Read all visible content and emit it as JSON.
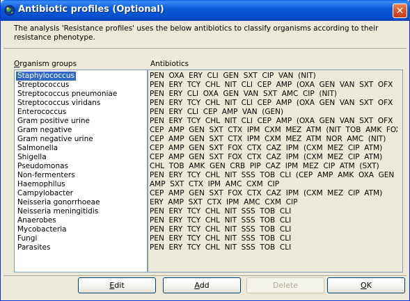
{
  "window": {
    "title": "Antibiotic profiles (Optional)",
    "close_label": "✕"
  },
  "description": "The analysis 'Resistance profiles' uses the below antibiotics to classify organisms according to their resistance phenotype.",
  "organism_groups_label": "Organism groups",
  "antibiotics_label": "Antibiotics",
  "organism_groups": [
    "Staphylococcus",
    "Streptococcus",
    "Streptococcus pneumoniae",
    "Streptococcus viridans",
    "Enterococcus",
    "Gram positive urine",
    "Gram negative",
    "Gram negative urine",
    "Salmonella",
    "Shigella",
    "Pseudomonas",
    "Non-fermenters",
    "Haemophilus",
    "Campylobacter",
    "Neisseria gonorrhoeae",
    "Neisseria meningitidis",
    "Anaerobes",
    "Mycobacteria",
    "Fungi",
    "Parasites"
  ],
  "selected_index": 0,
  "antibiotics": [
    "PEN  OXA  ERY  CLI  GEN  SXT  CIP  VAN  (NIT)",
    "PEN  ERY  TCY  CHL  NIT  CLI  CEP  AMP  (OXA  GEN  VAN  SXT  OFX  C",
    "PEN  ERY  CLI  OXA  GEN  VAN  SXT  AMC  CIP  (NIT)",
    "PEN  ERY  TCY  CHL  NIT  CLI  CEP  AMP  (OXA  GEN  VAN  SXT  OFX  C",
    "PEN  ERY  CLI  CEP  AMP  VAN  (GEN)",
    "PEN  ERY  TCY  CHL  NIT  CLI  CEP  AMP  (OXA  GEN  VAN  SXT  OFX  C",
    "CEP  AMP  GEN  SXT  CTX  IPM  CXM  MEZ  ATM  (NIT  TOB  AMK  FOX",
    "CEP  AMP  GEN  SXT  CTX  IPM  CXM  MEZ  ATM  NOR  AMC  (NIT)",
    "CEP  AMP  GEN  SXT  FOX  CTX  CAZ  IPM  (CXM  MEZ  CIP  ATM)",
    "CEP  AMP  GEN  SXT  FOX  CTX  CAZ  IPM  (CXM  MEZ  CIP  ATM)",
    "CHL  TOB  AMK  GEN  CRB  PIP  CAZ  IPM  MEZ  CIP  ATM  (SXT)",
    "PEN  ERY  TCY  CHL  NIT  SSS  TOB  CLI  (CEP  AMP  AMK  OXA  GEN",
    "AMP  SXT  CTX  IPM  AMC  CXM  CIP",
    "CEP  AMP  GEN  SXT  FOX  CTX  CAZ  IPM  (CXM  MEZ  CIP  ATM)",
    "ERY  AMP  SXT  CTX  IPM  AMC  CXM  CIP",
    "PEN  ERY  TCY  CHL  NIT  SSS  TOB  CLI",
    "PEN  ERY  TCY  CHL  NIT  SSS  TOB  CLI",
    "PEN  ERY  TCY  CHL  NIT  SSS  TOB  CLI",
    "PEN  ERY  TCY  CHL  NIT  SSS  TOB  CLI",
    "PEN  ERY  TCY  CHL  NIT  SSS  TOB  CLI"
  ],
  "buttons": {
    "edit": "Edit",
    "add": "Add",
    "delete": "Delete",
    "ok": "OK"
  },
  "colors": {
    "titlebar": "#0b5ad9",
    "selection": "#316ac5",
    "dialog_bg": "#ece9d8",
    "close_button": "#d9532e"
  }
}
